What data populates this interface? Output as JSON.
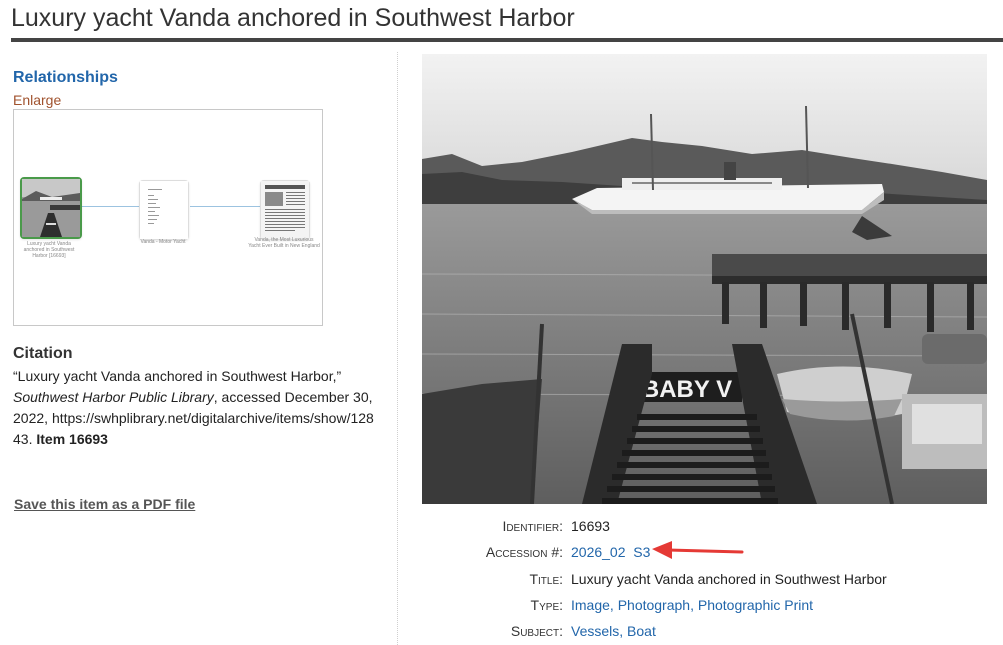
{
  "page": {
    "title": "Luxury yacht Vanda anchored in Southwest Harbor"
  },
  "relationships": {
    "heading": "Relationships",
    "enlarge": "Enlarge",
    "nodes": [
      {
        "caption": "Luxury yacht Vanda anchored in Southwest Harbor [16693]"
      },
      {
        "caption": "Vanda - Motor Yacht"
      },
      {
        "caption": "Vanda, the Most Luxurious Yacht Ever Built in New England"
      }
    ]
  },
  "citation": {
    "heading": "Citation",
    "quote": "“Luxury yacht Vanda anchored in Southwest Harbor,”",
    "source": "Southwest Harbor Public Library",
    "accessed": ", accessed December 30, 2022,",
    "url": "https://swhplibrary.net/digitalarchive/items/show/12843.",
    "item": "Item 16693"
  },
  "pdf_link": "Save this item as a PDF file",
  "photo": {
    "sign_text": "BABY V"
  },
  "metadata": {
    "identifier": {
      "label": "Identifier:",
      "value": "16693"
    },
    "accession": {
      "label": "Accession #:",
      "value": "2026_02  S3"
    },
    "title": {
      "label": "Title:",
      "value": "Luxury yacht Vanda anchored in Southwest Harbor"
    },
    "type": {
      "label": "Type:",
      "value": "Image, Photograph, Photographic Print"
    },
    "subject": {
      "label": "Subject:",
      "value": "Vessels, Boat"
    }
  },
  "colors": {
    "link": "#2266aa",
    "arrow": "#e53935",
    "enlarge": "#a0522d"
  }
}
